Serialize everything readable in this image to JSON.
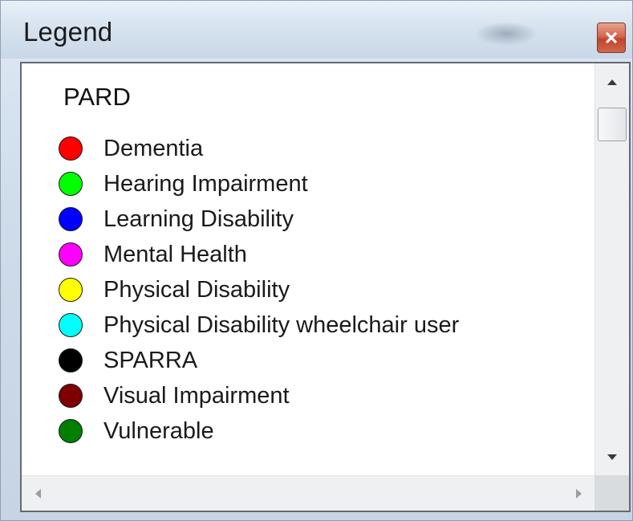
{
  "window": {
    "title": "Legend",
    "close_icon": "close-icon"
  },
  "legend": {
    "group_title": "PARD",
    "items": [
      {
        "label": "Dementia",
        "color": "#ff0000"
      },
      {
        "label": "Hearing Impairment",
        "color": "#00ff00"
      },
      {
        "label": "Learning Disability",
        "color": "#0000ff"
      },
      {
        "label": "Mental Health",
        "color": "#ff00ff"
      },
      {
        "label": "Physical Disability",
        "color": "#ffff00"
      },
      {
        "label": "Physical Disability wheelchair user",
        "color": "#00ffff"
      },
      {
        "label": "SPARRA",
        "color": "#000000"
      },
      {
        "label": "Visual Impairment",
        "color": "#7f0000"
      },
      {
        "label": "Vulnerable",
        "color": "#007f00"
      }
    ]
  },
  "scrollbars": {
    "vertical_up_icon": "arrow-up-icon",
    "vertical_down_icon": "arrow-down-icon",
    "horizontal_left_icon": "arrow-left-icon",
    "horizontal_right_icon": "arrow-right-icon"
  }
}
